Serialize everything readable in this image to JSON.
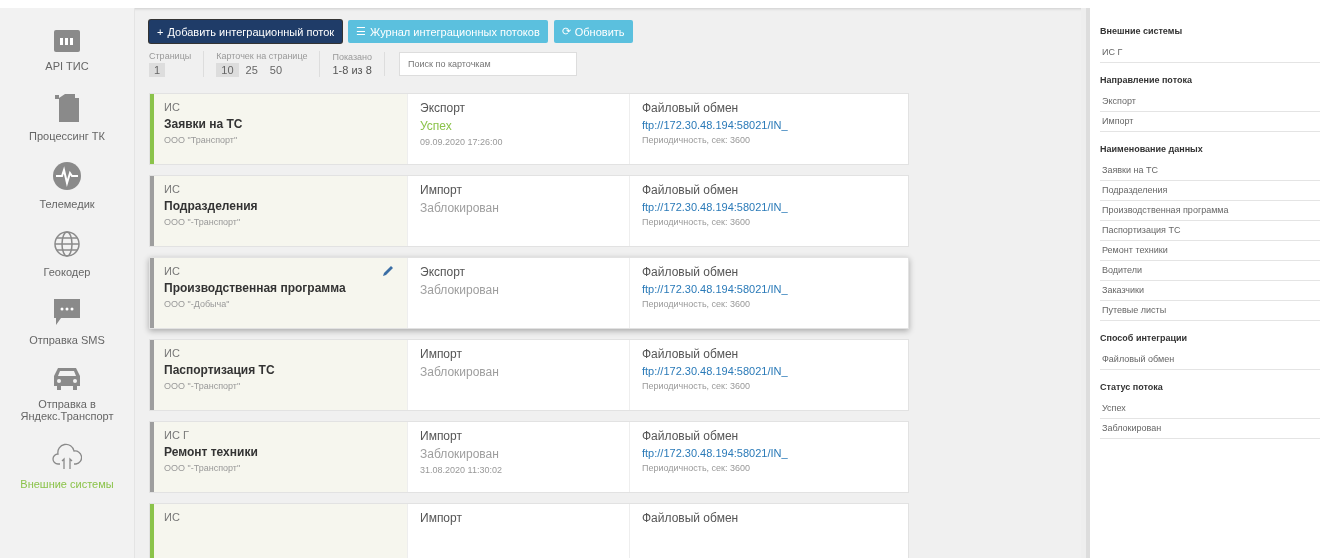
{
  "sidebar": {
    "items": [
      {
        "label": "API ТИС",
        "kind": "api",
        "selected": false
      },
      {
        "label": "Процессинг ТК",
        "kind": "canister",
        "selected": false
      },
      {
        "label": "Телемедик",
        "kind": "pulse",
        "selected": false
      },
      {
        "label": "Геокодер",
        "kind": "globe",
        "selected": false
      },
      {
        "label": "Отправка SMS",
        "kind": "chat",
        "selected": false
      },
      {
        "label": "Отправка в Яндекс.Транспорт",
        "kind": "car",
        "selected": false
      },
      {
        "label": "Внешние системы",
        "kind": "cloud",
        "selected": true
      }
    ]
  },
  "toolbar": {
    "buttons": [
      {
        "label": "Добавить интеграционный поток",
        "icon": "+",
        "kind": "primary"
      },
      {
        "label": "Журнал интеграционных потоков",
        "icon": "☰",
        "kind": "info"
      },
      {
        "label": "Обновить",
        "icon": "⟳",
        "kind": "info"
      }
    ]
  },
  "pager": {
    "pages_label": "Страницы",
    "pages": [
      {
        "label": "1",
        "selected": true
      }
    ],
    "per_page_label": "Карточек на странице",
    "per_page": [
      {
        "label": "10",
        "selected": true
      },
      {
        "label": "25",
        "selected": false
      },
      {
        "label": "50",
        "selected": false
      }
    ],
    "shown_label": "Показано",
    "shown": "1-8 из 8",
    "search": {
      "placeholder": "Поиск по карточкам"
    }
  },
  "cards": [
    {
      "system": "ИС",
      "title": "Заявки на ТС",
      "org": "ООО \"Транспорт\"",
      "direction": "Экспорт",
      "status": "Успех",
      "date": "09.09.2020 17:26:00",
      "method": "Файловый обмен",
      "url": "ftp://172.30.48.194:58021/IN_",
      "period": "Периодичность, сек: 3600",
      "color": "#8bc34a",
      "highlighted": false
    },
    {
      "system": "ИС",
      "title": "Подразделения",
      "org": "ООО \"-Транспорт\"",
      "direction": "Импорт",
      "status": "Заблокирован",
      "method": "Файловый обмен",
      "url": "ftp://172.30.48.194:58021/IN_",
      "period": "Периодичность, сек: 3600",
      "color": "#9e9e9e",
      "highlighted": false
    },
    {
      "system": "ИС",
      "title": "Производственная программа",
      "org": "ООО \"-Добыча\"",
      "direction": "Экспорт",
      "status": "Заблокирован",
      "method": "Файловый обмен",
      "url": "ftp://172.30.48.194:58021/IN_",
      "period": "Периодичность, сек: 3600",
      "color": "#9e9e9e",
      "highlighted": true
    },
    {
      "system": "ИС",
      "title": "Паспортизация ТС",
      "org": "ООО \"-Транспорт\"",
      "direction": "Импорт",
      "status": "Заблокирован",
      "method": "Файловый обмен",
      "url": "ftp://172.30.48.194:58021/IN_",
      "period": "Периодичность, сек: 3600",
      "color": "#9e9e9e",
      "highlighted": false
    },
    {
      "system": "ИС Г",
      "title": "Ремонт техники",
      "org": "ООО \"-Транспорт\"",
      "direction": "Импорт",
      "status": "Заблокирован",
      "date": "31.08.2020 11:30:02",
      "method": "Файловый обмен",
      "url": "ftp://172.30.48.194:58021/IN_",
      "period": "Периодичность, сек: 3600",
      "color": "#9e9e9e",
      "highlighted": false
    },
    {
      "system": "ИС",
      "direction": "Импорт",
      "method": "Файловый обмен",
      "color": "#8bc34a",
      "highlighted": false
    }
  ],
  "filters": [
    {
      "heading": "Внешние системы",
      "items": [
        "ИС Г"
      ]
    },
    {
      "heading": "Направление потока",
      "items": [
        "Экспорт",
        "Импорт"
      ]
    },
    {
      "heading": "Наименование данных",
      "items": [
        "Заявки на ТС",
        "Подразделения",
        "Производственная программа",
        "Паспортизация ТС",
        "Ремонт техники",
        "Водители",
        "Заказчики",
        "Путевые листы"
      ]
    },
    {
      "heading": "Способ интеграции",
      "items": [
        "Файловый обмен"
      ]
    },
    {
      "heading": "Статус потока",
      "items": [
        "Успех",
        "Заблокирован"
      ]
    }
  ]
}
